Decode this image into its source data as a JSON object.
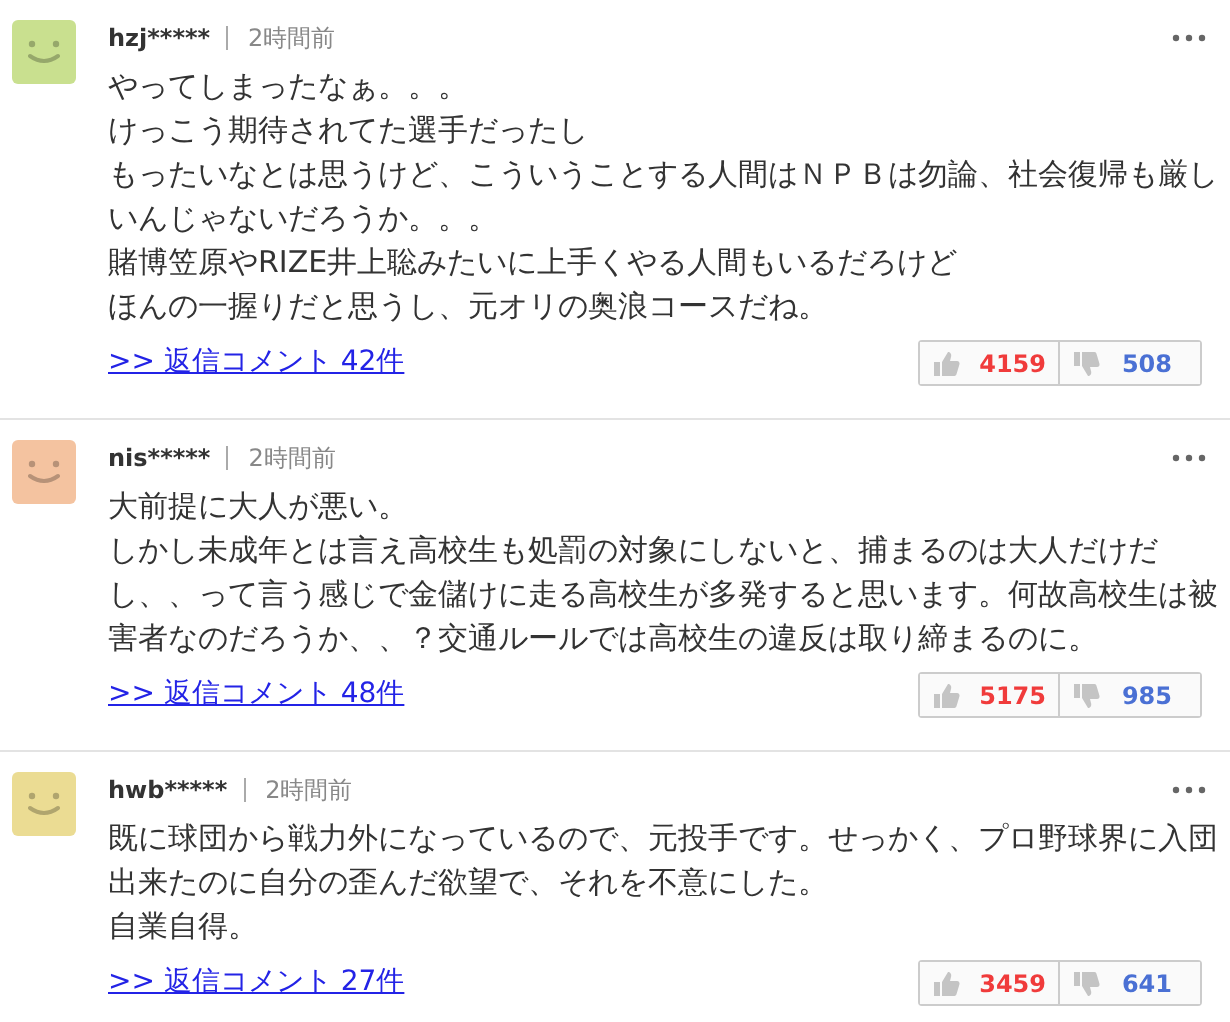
{
  "comments": [
    {
      "user": "hzj*****",
      "time": "2時間前",
      "color": "#c9e08f",
      "lines": [
        "やってしまったなぁ。。。",
        "けっこう期待されてた選手だったし",
        "もったいなとは思うけど、こういうことする人間はＮＰＢは勿論、社会復帰も厳しいんじゃないだろうか。。。",
        "賭博笠原やRIZE井上聡みたいに上手くやる人間もいるだろけど",
        "ほんの一握りだと思うし、元オリの奥浪コースだね。"
      ],
      "replies": ">> 返信コメント 42件",
      "up": "4159",
      "down": "508"
    },
    {
      "user": "nis*****",
      "time": "2時間前",
      "color": "#f4c3a0",
      "lines": [
        "大前提に大人が悪い。",
        "しかし未成年とは言え高校生も処罰の対象にしないと、捕まるのは大人だけだし、、って言う感じで金儲けに走る高校生が多発すると思います。何故高校生は被害者なのだろうか、、？交通ルールでは高校生の違反は取り締まるのに。"
      ],
      "replies": ">> 返信コメント 48件",
      "up": "5175",
      "down": "985"
    },
    {
      "user": "hwb*****",
      "time": "2時間前",
      "color": "#ebdc93",
      "lines": [
        "既に球団から戦力外になっているので、元投手です。せっかく、プロ野球界に入団出来たのに自分の歪んだ欲望で、それを不意にした。",
        "自業自得。"
      ],
      "replies": ">> 返信コメント 27件",
      "up": "3459",
      "down": "641"
    }
  ]
}
